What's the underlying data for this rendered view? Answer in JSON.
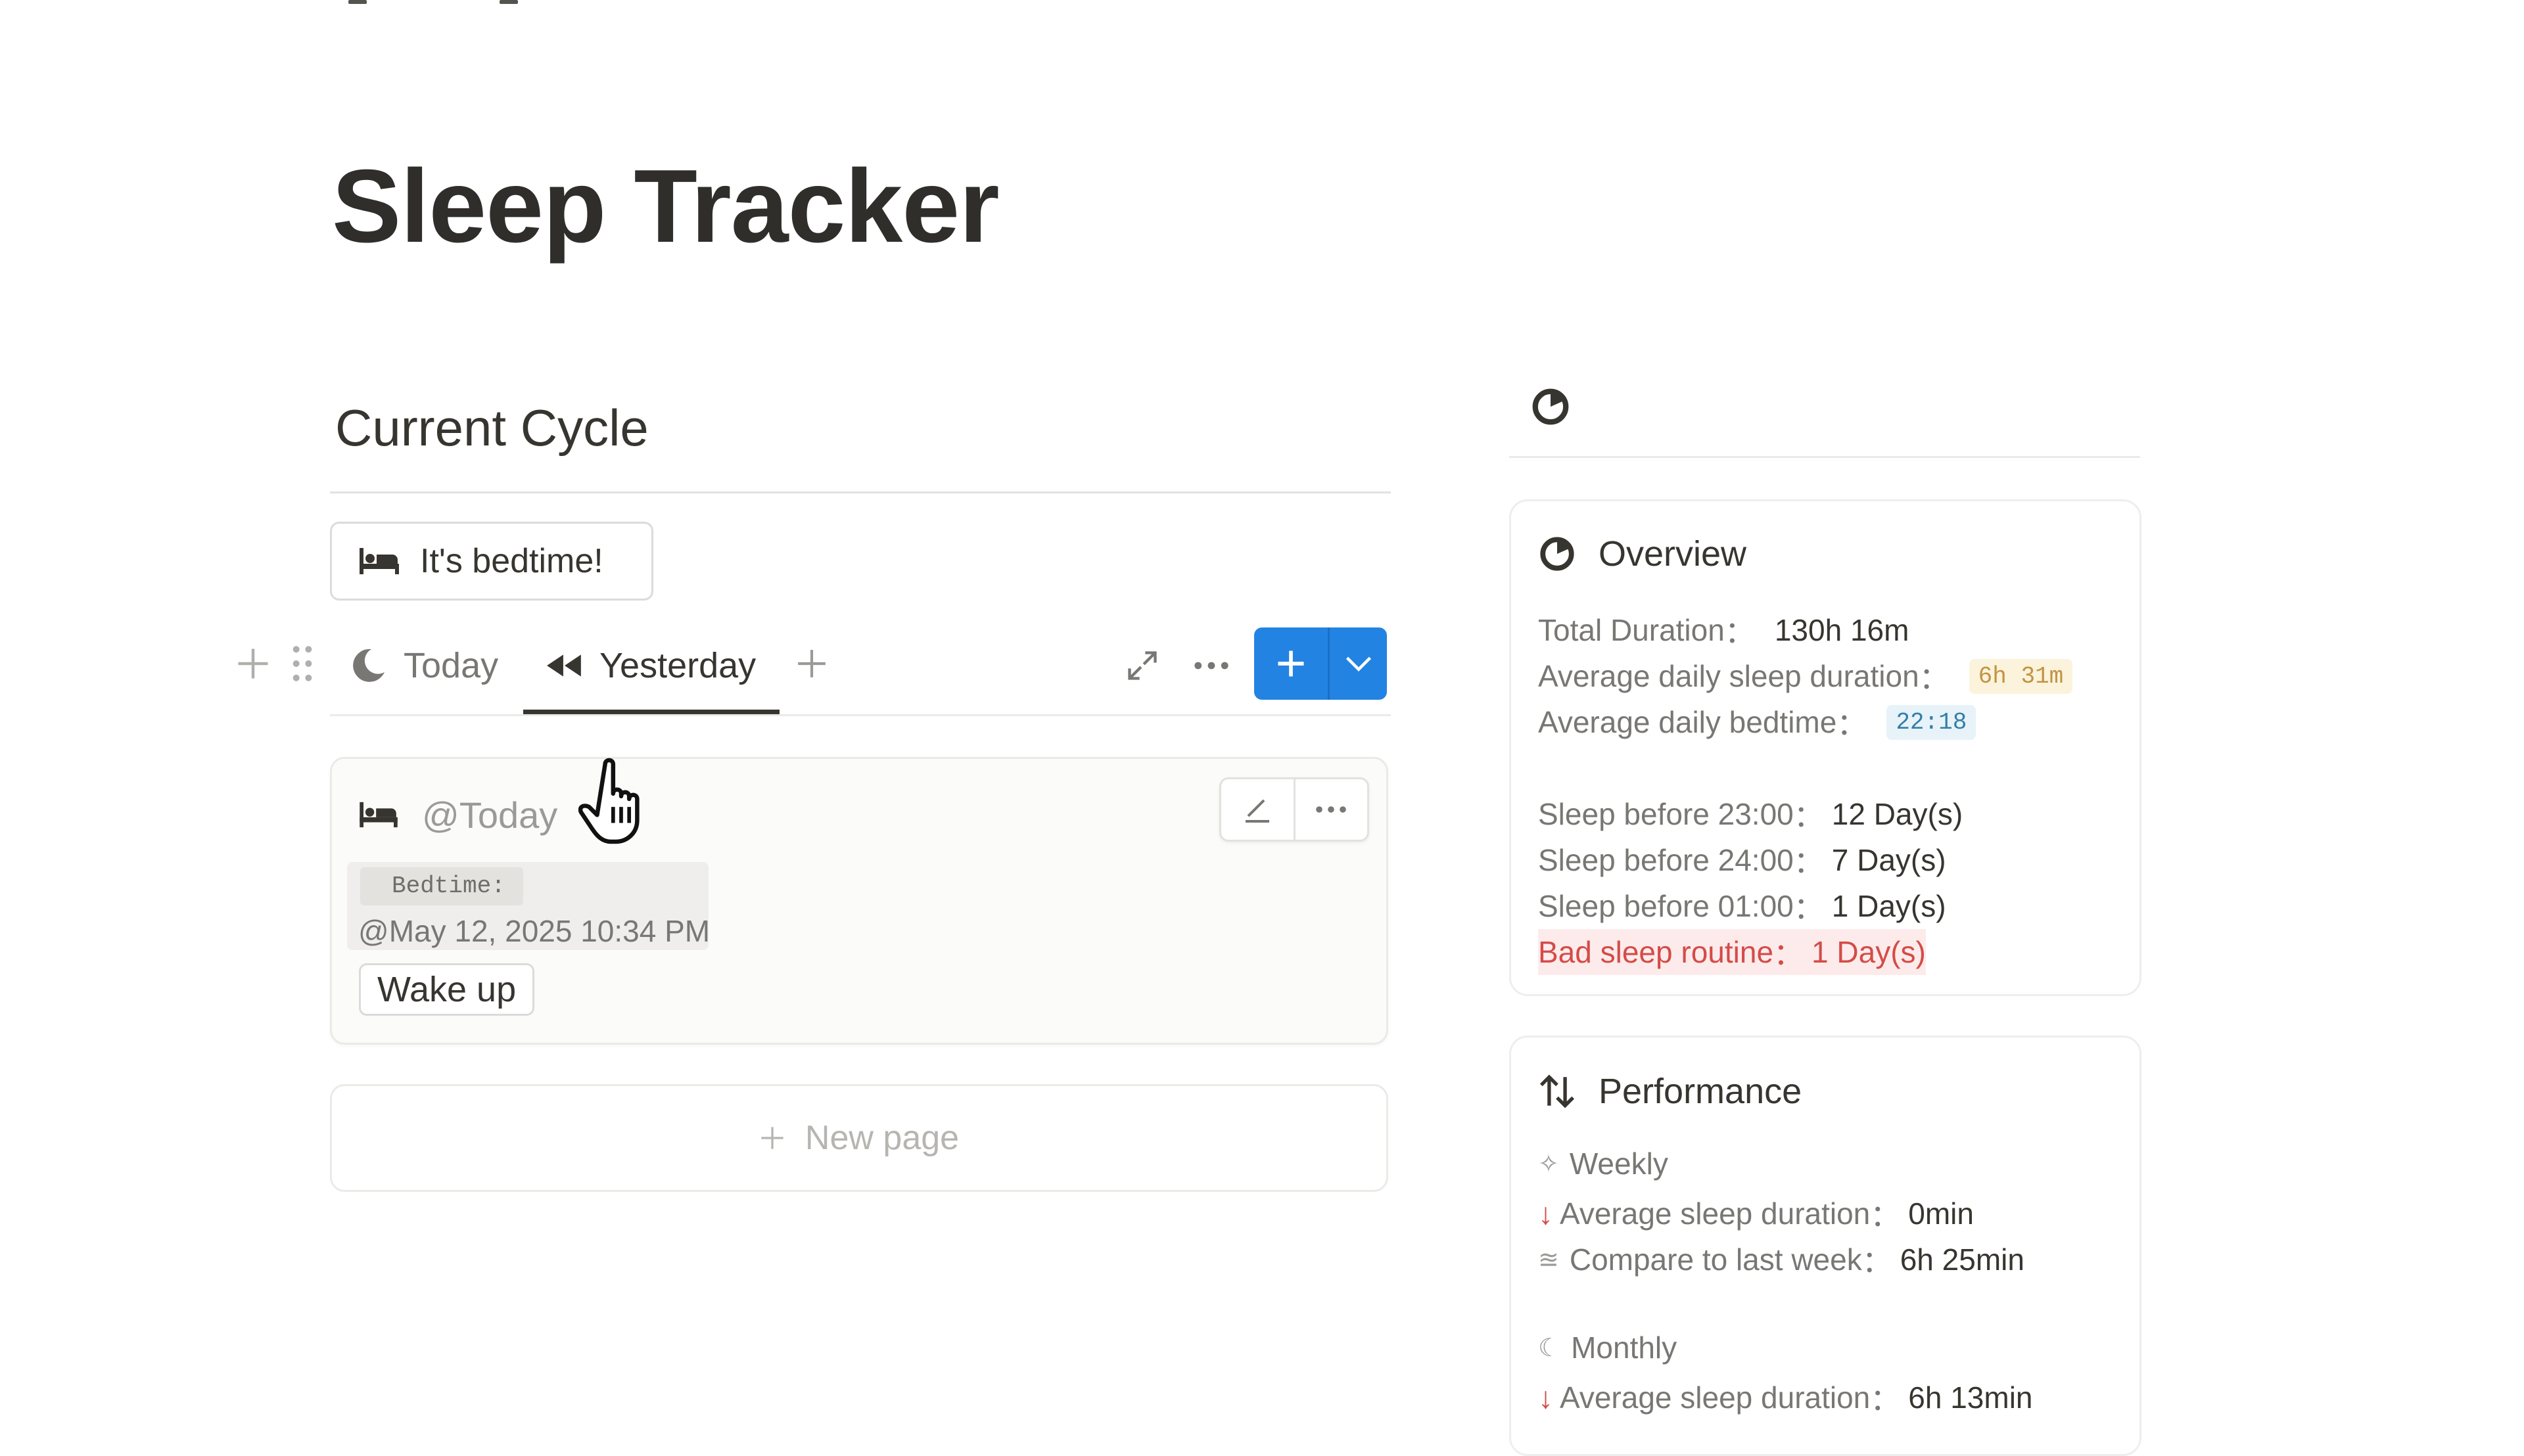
{
  "page": {
    "title": "Sleep Tracker"
  },
  "cycle": {
    "heading": "Current Cycle",
    "bedtime_button": "It's bedtime!",
    "tabs": [
      {
        "label": "Today",
        "icon": "moon-icon"
      },
      {
        "label": "Yesterday",
        "icon": "rewind-icon",
        "active": true
      }
    ],
    "card": {
      "title": "@Today",
      "bedtime_label": "Bedtime:",
      "bedtime_value": "@May 12, 2025 10:34 PM",
      "wakeup_label": "Wake up"
    },
    "new_page_label": "New page"
  },
  "overview": {
    "title": "Overview",
    "total_duration": {
      "label": "Total Duration",
      "value": "130h 16m"
    },
    "avg_duration": {
      "label": "Average daily sleep duration",
      "value": "6h 31m"
    },
    "avg_bedtime": {
      "label": "Average daily bedtime",
      "value": "22:18"
    },
    "before_23": {
      "label": "Sleep before 23:00",
      "value": "12 Day(s)"
    },
    "before_24": {
      "label": "Sleep before 24:00",
      "value": "7 Day(s)"
    },
    "before_01": {
      "label": "Sleep before 01:00",
      "value": "1 Day(s)"
    },
    "bad_routine": {
      "label": "Bad sleep routine",
      "value": "1 Day(s)"
    },
    "colon": "："
  },
  "performance": {
    "title": "Performance",
    "weekly_label": "Weekly",
    "weekly_avg": {
      "label": "Average sleep duration",
      "value": "0min"
    },
    "weekly_compare": {
      "label": "Compare to last week",
      "value": "6h 25min"
    },
    "monthly_label": "Monthly",
    "monthly_avg": {
      "label": "Average sleep duration",
      "value": "6h 13min"
    }
  },
  "colors": {
    "accent": "#2383e2",
    "danger": "#d44c47",
    "yellow_pill": "#fbf3db",
    "blue_pill": "#e7f3f8"
  }
}
